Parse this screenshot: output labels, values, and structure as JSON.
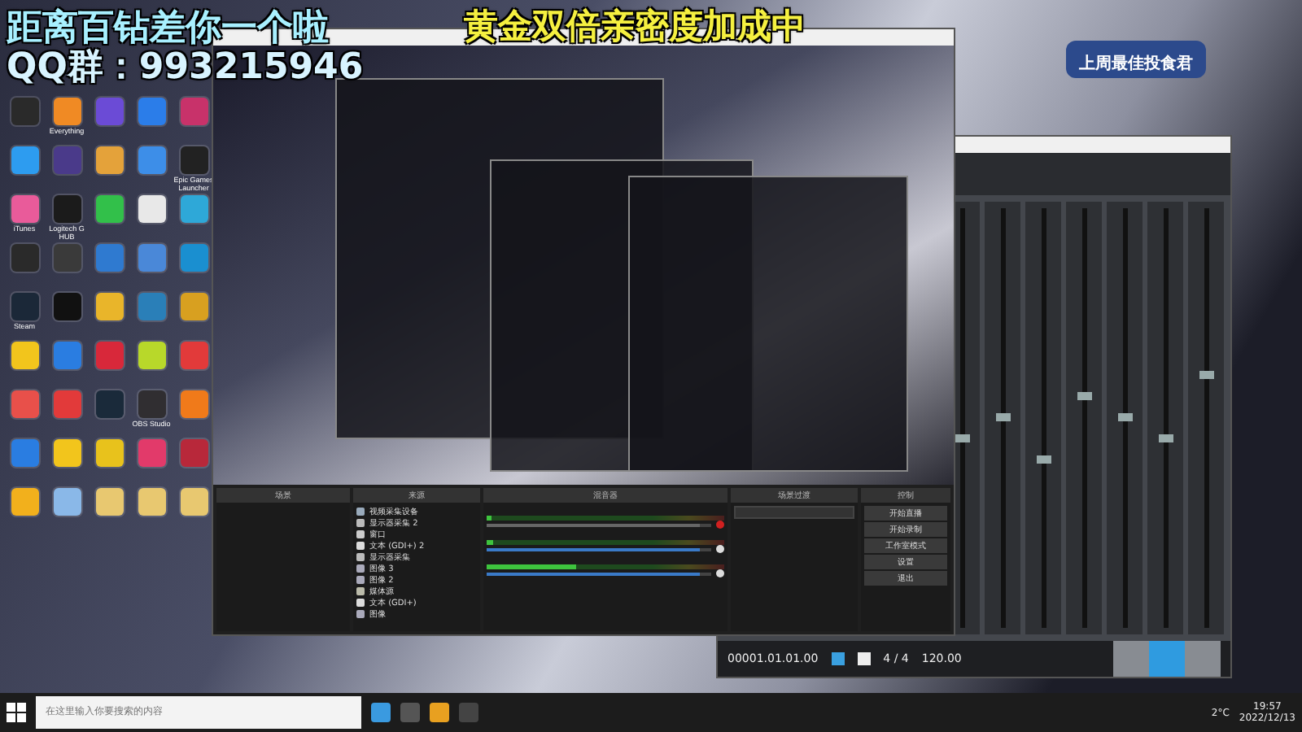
{
  "overlays": {
    "goal": "距离百钻差你一个啦",
    "qq": "QQ群：993215946",
    "bonus": "黄金双倍亲密度加成中",
    "badge": "上周最佳投食君"
  },
  "desktop_icons": [
    {
      "color": "#2a2a2a"
    },
    {
      "label": "Everything",
      "color": "#f08a24"
    },
    {
      "color": "#6b4bd6"
    },
    {
      "color": "#2b7de9"
    },
    {
      "color": "#c8326a"
    },
    {
      "color": "#2d9cf0"
    },
    {
      "color": "#4a3a8a"
    },
    {
      "color": "#e4a23a"
    },
    {
      "color": "#3d8ee8"
    },
    {
      "label": "Epic Games Launcher",
      "color": "#222222"
    },
    {
      "label": "iTunes",
      "color": "#e95b9a"
    },
    {
      "label": "Logitech G HUB",
      "color": "#1b1b1b"
    },
    {
      "color": "#32c04a"
    },
    {
      "color": "#e8e8e8"
    },
    {
      "color": "#2ea8d8"
    },
    {
      "color": "#2a2a2a"
    },
    {
      "color": "#3a3a3a"
    },
    {
      "color": "#2f7ad0"
    },
    {
      "color": "#4a88d8"
    },
    {
      "color": "#1a8fd0"
    },
    {
      "label": "Steam",
      "color": "#1b2838"
    },
    {
      "color": "#111111"
    },
    {
      "color": "#e9b52a"
    },
    {
      "color": "#2a7fb8"
    },
    {
      "color": "#d8a020"
    },
    {
      "color": "#f2c51c"
    },
    {
      "color": "#2a7de1"
    },
    {
      "color": "#d8283a"
    },
    {
      "color": "#b8d82a"
    },
    {
      "color": "#e23a3a"
    },
    {
      "color": "#e8504a"
    },
    {
      "color": "#e23a3a"
    },
    {
      "color": "#1a2a3a"
    },
    {
      "label": "OBS Studio",
      "color": "#302e31"
    },
    {
      "color": "#f07a1a"
    },
    {
      "color": "#2a7de1"
    },
    {
      "color": "#f2c51c"
    },
    {
      "color": "#e8c21c"
    },
    {
      "color": "#e23a6a"
    },
    {
      "color": "#b8283a"
    },
    {
      "color": "#f2b01c"
    },
    {
      "color": "#8ab8e8"
    },
    {
      "color": "#e8c870"
    },
    {
      "color": "#e8c870"
    },
    {
      "color": "#e8c870"
    }
  ],
  "obs": {
    "docks": [
      {
        "title": "场景"
      },
      {
        "title": "来源"
      },
      {
        "title": "混音器"
      },
      {
        "title": "场景过渡"
      },
      {
        "title": "控制"
      }
    ],
    "sources": [
      {
        "kind": "camera",
        "name": "视频采集设备"
      },
      {
        "kind": "monitor",
        "name": "显示器采集 2"
      },
      {
        "kind": "window",
        "name": "窗口"
      },
      {
        "kind": "text",
        "name": "文本 (GDI+) 2"
      },
      {
        "kind": "monitor",
        "name": "显示器采集"
      },
      {
        "kind": "image",
        "name": "图像 3"
      },
      {
        "kind": "image",
        "name": "图像 2"
      },
      {
        "kind": "media",
        "name": "媒体源"
      },
      {
        "kind": "text",
        "name": "文本 (GDI+)"
      },
      {
        "kind": "image",
        "name": "图像"
      }
    ],
    "mixer": [
      {
        "muted": true,
        "meter": {
          "level": 0.02
        },
        "fader": {
          "level": 0.95
        }
      },
      {
        "muted": false,
        "meter": {
          "level": 0.03
        },
        "fader": {
          "level": 0.95
        }
      },
      {
        "muted": false,
        "meter": {
          "level": 0.38
        },
        "fader": {
          "level": 0.95
        }
      }
    ],
    "controls": [
      "开始直播",
      "开始录制",
      "工作室模式",
      "设置",
      "退出"
    ]
  },
  "daw": {
    "strips": [
      {
        "level": 0.45
      },
      {
        "level": 0.5
      },
      {
        "level": 0.4
      },
      {
        "level": 0.55
      },
      {
        "level": 0.5
      },
      {
        "level": 0.45
      },
      {
        "level": 0.6
      }
    ],
    "time": "00001.01.01.00",
    "signature": "4 / 4",
    "tempo": "120.00",
    "tabs": [
      {
        "selected": false
      },
      {
        "selected": true
      },
      {
        "selected": false
      }
    ]
  },
  "taskbar": {
    "search_placeholder": "在这里输入你要搜索的内容",
    "weather": "2°C",
    "time": "19:57",
    "date": "2022/12/13"
  }
}
